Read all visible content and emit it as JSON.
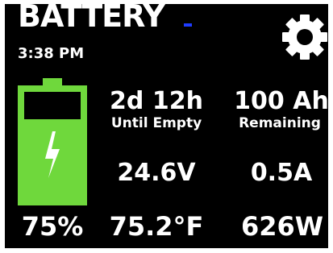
{
  "header": {
    "title": "BATTERY",
    "time": "3:38 PM",
    "indicator_color": "#1e3cff"
  },
  "icons": {
    "settings": "gear-icon",
    "battery": "battery-charging-icon"
  },
  "colors": {
    "battery_fill": "#6fd83c",
    "background": "#000000",
    "text": "#ffffff"
  },
  "battery": {
    "percent": 75,
    "percent_label": "75%",
    "charging": true
  },
  "stats": {
    "time_remaining": "2d 12h",
    "time_remaining_label": "Until Empty",
    "capacity_remaining": "100 Ah",
    "capacity_remaining_label": "Remaining",
    "voltage": "24.6V",
    "current": "0.5A",
    "temperature": "75.2°F",
    "power": "626W"
  }
}
